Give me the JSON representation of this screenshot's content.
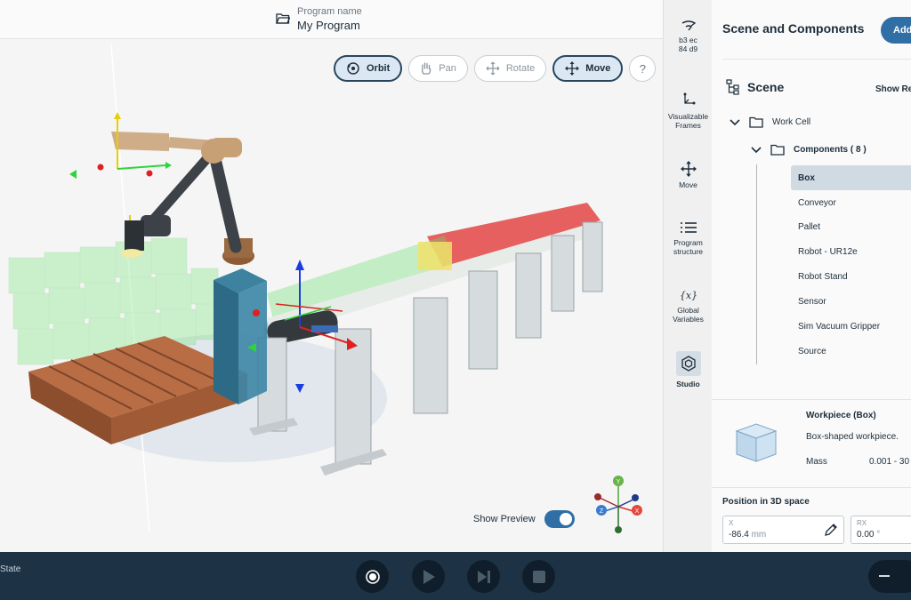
{
  "header": {
    "program_label": "Program name",
    "program_name": "My Program"
  },
  "toolbar": {
    "orbit": "Orbit",
    "pan": "Pan",
    "rotate": "Rotate",
    "move": "Move",
    "help": "?"
  },
  "preview": {
    "label": "Show Preview",
    "enabled": true
  },
  "gizmo": {
    "y": "Y",
    "z": "Z",
    "x": "X"
  },
  "sidenav": {
    "id_text": "b3 ec\n84 d9",
    "items": [
      {
        "label": "Visualizable Frames",
        "icon": "frames-icon"
      },
      {
        "label": "Move",
        "icon": "move-icon"
      },
      {
        "label": "Program structure",
        "icon": "list-icon"
      },
      {
        "label": "Global Variables",
        "icon": "variables-icon"
      },
      {
        "label": "Studio",
        "icon": "studio-icon"
      }
    ]
  },
  "panel": {
    "title": "Scene and Components",
    "add": "Add",
    "scene": "Scene",
    "show_relations": "Show Re",
    "work_cell": "Work Cell",
    "components": "Components ( 8 )",
    "items": [
      "Box",
      "Conveyor",
      "Pallet",
      "Robot - UR12e",
      "Robot Stand",
      "Sensor",
      "Sim Vacuum Gripper",
      "Source"
    ],
    "selected": "Box",
    "info": {
      "title": "Workpiece (Box)",
      "description": "Box-shaped workpiece.",
      "mass_label": "Mass",
      "mass_value": "0.001 - 30"
    },
    "position": {
      "title": "Position in 3D space",
      "x_label": "X",
      "x_value": "-86.4",
      "x_unit": "mm",
      "rx_label": "RX",
      "rx_value": "0.00",
      "rx_unit": "°"
    }
  },
  "bottom": {
    "state": "State"
  },
  "colors": {
    "accent": "#2f6fa6",
    "active_button": "#dbe8f3",
    "bottom_bar": "#1d3345"
  }
}
